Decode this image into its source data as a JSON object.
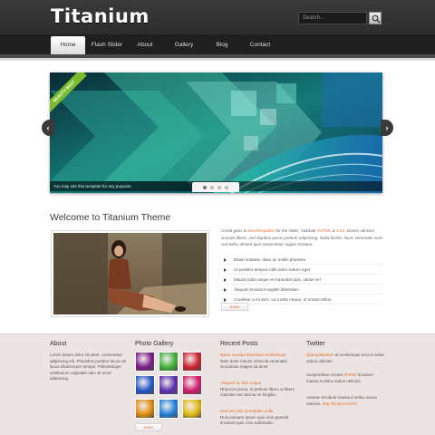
{
  "header": {
    "logo": "Titanium",
    "search_placeholder": "Search..."
  },
  "nav": {
    "items": [
      {
        "label": "Home",
        "active": true
      },
      {
        "label": "Flash Slider",
        "active": false
      },
      {
        "label": "About",
        "active": false
      },
      {
        "label": "Gallery",
        "active": false
      },
      {
        "label": "Blog",
        "active": false
      },
      {
        "label": "Contact",
        "active": false
      }
    ]
  },
  "slider": {
    "ribbon": "BEAUTY BEST",
    "caption": "You may use this template for any purpose.",
    "dots": 4,
    "active_dot": 0,
    "prev_label": "‹",
    "next_label": "›"
  },
  "welcome": {
    "title": "Welcome to Titanium Theme",
    "intro_prefix": "Credit goes to ",
    "intro_link": "DezTemplates",
    "intro_mid": " for the slider. Validate ",
    "intro_xhtml": "XHTML",
    "intro_and": " & ",
    "intro_css": "CSS",
    "intro_rest": ". Donec ultricies suscipit libero, sed dapibus purus pretium adipiscing. Nulla facilisi. Nunc venenatis nunc sed tellus dictum quis consectetur augue tristique.",
    "features": [
      "Etiam sodales, diam ac mollis pharetra",
      "Ut porttitor tempus nibh dolor rutrum eget",
      "Mauris justo neque et imperdiet quis, varius vel",
      "Aliquam tincidunt sagittis bibendum",
      "Curabitur a mi sem. Ut a ante neque, ut ornare tellus"
    ],
    "more_label": "more"
  },
  "footer": {
    "about": {
      "heading": "About",
      "text": "Lorem ipsum dolor sit amet, consectetur adipiscing elit. Phasellus porttitor lacus vel lacus ullamcorper tempor. Pellentesque vestibulum vulputate odio sit amet adipiscing."
    },
    "gallery": {
      "heading": "Photo Gallery",
      "more_label": "more",
      "colors": [
        "#7a1a86",
        "#3fae3a",
        "#c8202b",
        "#1f57c9",
        "#5a2bb0",
        "#d11a6a",
        "#e08a0d",
        "#1d7fd8",
        "#e0b712"
      ]
    },
    "recent": {
      "heading": "Recent Posts",
      "posts": [
        {
          "title": "Etiam suscipit bibendum scelerisque",
          "text": "Nam dolor mauris vehicula venenatis accumsan magna sit amet."
        },
        {
          "title": "Aliquam ac felis neque",
          "text": "Rhoncus purus, in pretium libero ut libero molestie nec lacinia mi fringilla."
        },
        {
          "title": "Sed vel justo ut sodales nulla",
          "text": "Duis posuere ipsum quis eros gravida tincidunt quis cras sollicitudin."
        }
      ]
    },
    "twitter": {
      "heading": "Twitter",
      "tweets": [
        {
          "link": "@templatedom",
          "text": " at scelerisque urna in tellus varius ultricies."
        },
        {
          "prefix": "Suspendisse ornare ",
          "link": "#FREE",
          "text": " tincidunt massa in tellus varius ultricies."
        },
        {
          "prefix": "Aenean tincidunt massa in tellus varius ultricies. ",
          "link": "http://bit.ly/13Ae2G",
          "text": ""
        }
      ]
    }
  },
  "colors": {
    "accent": "#e06f2c",
    "header_bg": "#2b2b2b",
    "footer_bg": "#ece4e2"
  }
}
